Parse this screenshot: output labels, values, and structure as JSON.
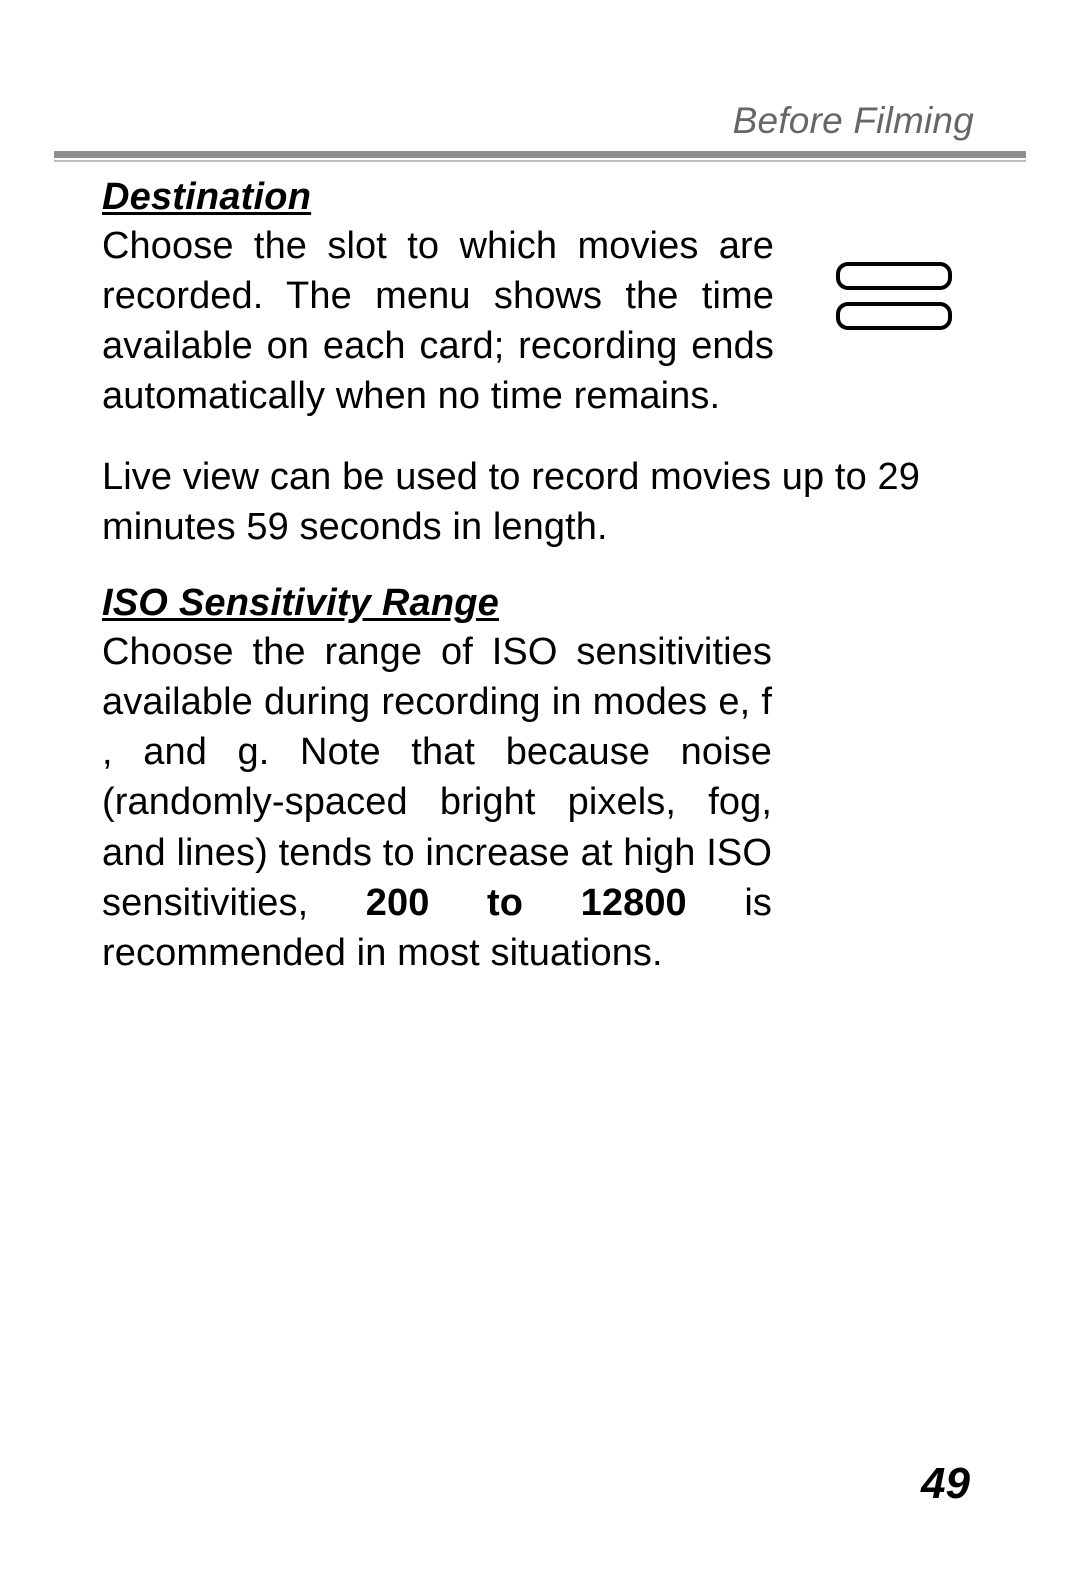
{
  "running_head": "Before Filming",
  "sections": {
    "destination": {
      "heading": "Destination",
      "para1": "Choose the slot to which movies are recorded. The menu shows the time available on each card; recording ends automatically when no time remains.",
      "para2": "Live view can be used to record movies up to 29 minutes 59 seconds in length."
    },
    "iso": {
      "heading": "ISO Sensitivity Range",
      "para_pre": "Choose the range of ISO sensitivities available during recording in modes e, f , and g. Note that because noise (randomly-spaced bright pixels, fog, and lines) tends to increase at high ISO sensitivities, ",
      "para_bold": "200 to 12800",
      "para_post": " is recommended in most situations."
    }
  },
  "page_number": "49"
}
